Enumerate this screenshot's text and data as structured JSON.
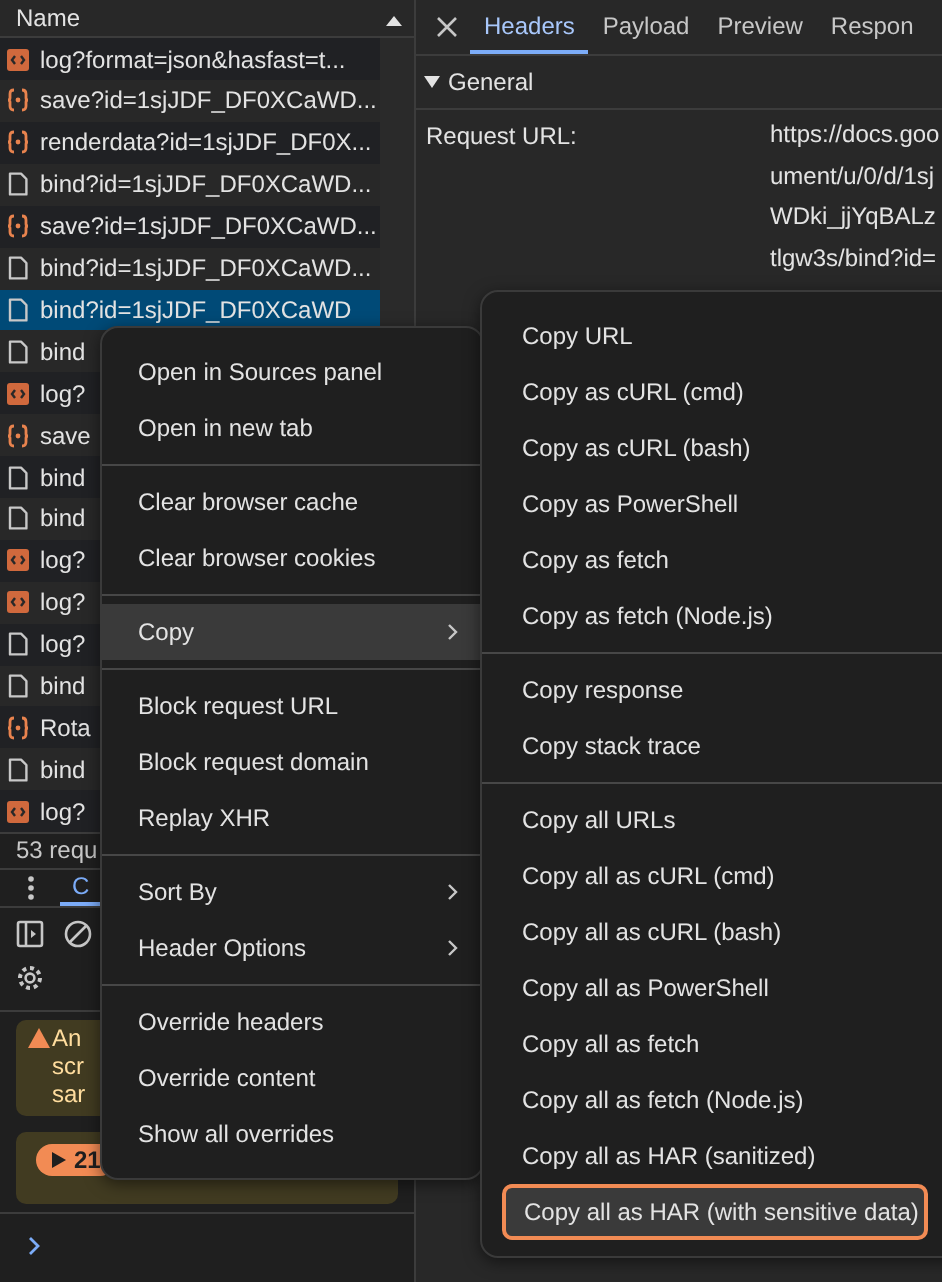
{
  "request_list": {
    "header": "Name",
    "rows": [
      {
        "name": "log?format=json&hasfast=t...",
        "kind": "xhr",
        "selected": false
      },
      {
        "name": "save?id=1sjJDF_DF0XCaWD...",
        "kind": "script",
        "selected": false
      },
      {
        "name": "renderdata?id=1sjJDF_DF0X...",
        "kind": "script",
        "selected": false
      },
      {
        "name": "bind?id=1sjJDF_DF0XCaWD...",
        "kind": "document",
        "selected": false
      },
      {
        "name": "save?id=1sjJDF_DF0XCaWD...",
        "kind": "script",
        "selected": false
      },
      {
        "name": "bind?id=1sjJDF_DF0XCaWD...",
        "kind": "document",
        "selected": false
      },
      {
        "name": "bind?id=1sjJDF_DF0XCaWD",
        "kind": "document",
        "selected": true
      },
      {
        "name": "bind",
        "kind": "document",
        "selected": false
      },
      {
        "name": "log?",
        "kind": "xhr",
        "selected": false
      },
      {
        "name": "save",
        "kind": "script",
        "selected": false
      },
      {
        "name": "bind",
        "kind": "document",
        "selected": false
      },
      {
        "name": "bind",
        "kind": "document",
        "selected": false
      },
      {
        "name": "log?",
        "kind": "xhr",
        "selected": false
      },
      {
        "name": "log?",
        "kind": "xhr",
        "selected": false
      },
      {
        "name": "log?",
        "kind": "document",
        "selected": false
      },
      {
        "name": "bind",
        "kind": "document",
        "selected": false
      },
      {
        "name": "Rota",
        "kind": "script",
        "selected": false
      },
      {
        "name": "bind",
        "kind": "document",
        "selected": false
      },
      {
        "name": "log?",
        "kind": "xhr",
        "selected": false
      }
    ]
  },
  "status_bar": "53 requ",
  "drawer": {
    "tabs": [
      {
        "label": "C",
        "selected": true
      }
    ],
    "warning_lines": [
      "An",
      "scr",
      "sar"
    ],
    "badge": "21"
  },
  "detail": {
    "tabs": [
      {
        "label": "Headers",
        "selected": true
      },
      {
        "label": "Payload",
        "selected": false
      },
      {
        "label": "Preview",
        "selected": false
      },
      {
        "label": "Respon",
        "selected": false
      }
    ],
    "section": {
      "title": "General",
      "expanded": true
    },
    "fields": [
      {
        "label": "Request URL:",
        "value_lines": [
          "https://docs.goo",
          "ument/u/0/d/1sj",
          "WDki_jjYqBALz",
          "tlgw3s/bind?id="
        ]
      }
    ]
  },
  "context_menu": {
    "groups": [
      [
        {
          "label": "Open in Sources panel",
          "submenu": false,
          "highlighted": false
        },
        {
          "label": "Open in new tab",
          "submenu": false,
          "highlighted": false
        }
      ],
      [
        {
          "label": "Clear browser cache",
          "submenu": false,
          "highlighted": false
        },
        {
          "label": "Clear browser cookies",
          "submenu": false,
          "highlighted": false
        }
      ],
      [
        {
          "label": "Copy",
          "submenu": true,
          "highlighted": true
        }
      ],
      [
        {
          "label": "Block request URL",
          "submenu": false,
          "highlighted": false
        },
        {
          "label": "Block request domain",
          "submenu": false,
          "highlighted": false
        },
        {
          "label": "Replay XHR",
          "submenu": false,
          "highlighted": false
        }
      ],
      [
        {
          "label": "Sort By",
          "submenu": true,
          "highlighted": false
        },
        {
          "label": "Header Options",
          "submenu": true,
          "highlighted": false
        }
      ],
      [
        {
          "label": "Override headers",
          "submenu": false,
          "highlighted": false
        },
        {
          "label": "Override content",
          "submenu": false,
          "highlighted": false
        },
        {
          "label": "Show all overrides",
          "submenu": false,
          "highlighted": false
        }
      ]
    ]
  },
  "copy_submenu": {
    "groups": [
      [
        {
          "label": "Copy URL",
          "highlighted": false,
          "outlined": false
        },
        {
          "label": "Copy as cURL (cmd)",
          "highlighted": false,
          "outlined": false
        },
        {
          "label": "Copy as cURL (bash)",
          "highlighted": false,
          "outlined": false
        },
        {
          "label": "Copy as PowerShell",
          "highlighted": false,
          "outlined": false
        },
        {
          "label": "Copy as fetch",
          "highlighted": false,
          "outlined": false
        },
        {
          "label": "Copy as fetch (Node.js)",
          "highlighted": false,
          "outlined": false
        }
      ],
      [
        {
          "label": "Copy response",
          "highlighted": false,
          "outlined": false
        },
        {
          "label": "Copy stack trace",
          "highlighted": false,
          "outlined": false
        }
      ],
      [
        {
          "label": "Copy all URLs",
          "highlighted": false,
          "outlined": false
        },
        {
          "label": "Copy all as cURL (cmd)",
          "highlighted": false,
          "outlined": false
        },
        {
          "label": "Copy all as cURL (bash)",
          "highlighted": false,
          "outlined": false
        },
        {
          "label": "Copy all as PowerShell",
          "highlighted": false,
          "outlined": false
        },
        {
          "label": "Copy all as fetch",
          "highlighted": false,
          "outlined": false
        },
        {
          "label": "Copy all as fetch (Node.js)",
          "highlighted": false,
          "outlined": false
        },
        {
          "label": "Copy all as HAR (sanitized)",
          "highlighted": false,
          "outlined": false
        },
        {
          "label": "Copy all as HAR (with sensitive data)",
          "highlighted": true,
          "outlined": true
        }
      ]
    ]
  }
}
